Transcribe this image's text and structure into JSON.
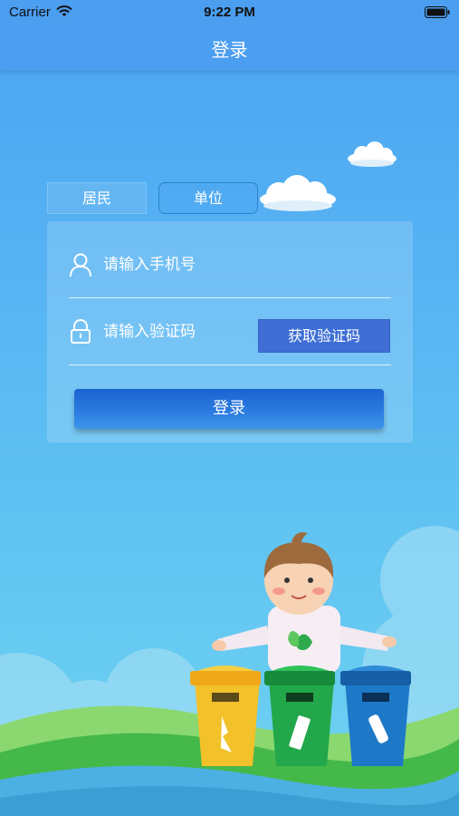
{
  "status_bar": {
    "carrier": "Carrier",
    "time": "9:22 PM"
  },
  "nav": {
    "title": "登录"
  },
  "tabs": [
    {
      "label": "居民",
      "active": true
    },
    {
      "label": "单位",
      "active": false
    }
  ],
  "form": {
    "phone_placeholder": "请输入手机号",
    "code_placeholder": "请输入验证码",
    "get_code_label": "获取验证码",
    "login_label": "登录"
  },
  "colors": {
    "nav_bg": "#4b9ef0",
    "code_button": "#3f6fd6",
    "login_button": "#2a7be0",
    "bin_yellow": "#f3c12a",
    "bin_green": "#22a84a",
    "bin_blue": "#1d78c8"
  }
}
